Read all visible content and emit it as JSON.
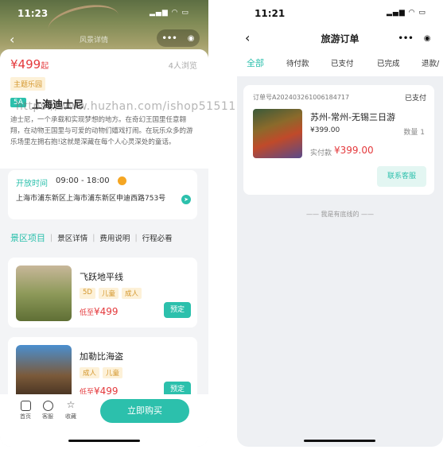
{
  "left": {
    "status_time": "11:23",
    "nav_title": "风景详情",
    "price": "¥499",
    "price_suffix": "起",
    "views": "4人浏览",
    "theme_tag": "主题乐园",
    "level": "5A",
    "name": "上海迪士尼",
    "description": "迪士尼，一个承载和实现梦想的地方。在奇幻王国里任意翱翔，在动物王国里与可爱的动物们嬉戏打闹。在玩乐众多的游乐场里左拥右抱!这就是深藏在每个人心灵深处的童话。",
    "open_label": "开放时间",
    "open_time": "09:00 - 18:00",
    "address": "上海市浦东新区上海市浦东新区申迪西路753号",
    "tabs": [
      "景区项目",
      "景区详情",
      "费用说明",
      "行程必看"
    ],
    "products": [
      {
        "name": "飞跃地平线",
        "tags": [
          "5D",
          "儿童",
          "成人"
        ],
        "price_prefix": "低至",
        "price": "¥499",
        "book": "预定"
      },
      {
        "name": "加勒比海盗",
        "tags": [
          "成人",
          "儿童"
        ],
        "price_prefix": "低至",
        "price": "¥499",
        "book": "预定"
      }
    ],
    "bottom": {
      "home": "首页",
      "service": "客服",
      "fav": "收藏",
      "buy": "立即购买"
    }
  },
  "watermark": "https://www.huzhan.com/ishop51511",
  "right": {
    "status_time": "11:21",
    "title": "旅游订单",
    "tabs": [
      "全部",
      "待付款",
      "已支付",
      "已完成",
      "退款/"
    ],
    "order": {
      "no": "订单号A202403261006184717",
      "status": "已支付",
      "name": "苏州-常州-无锡三日游",
      "price": "¥399.00",
      "qty": "数量 1",
      "paid_label": "实付款",
      "paid": "¥399.00",
      "service_btn": "联系客服"
    },
    "bottom_line": "—— 我是有底线的 ——"
  },
  "colors": {
    "accent": "#2cc0ac",
    "price": "#e4393c",
    "tag_bg": "#fdf1d8",
    "tag_fg": "#d4972e"
  }
}
